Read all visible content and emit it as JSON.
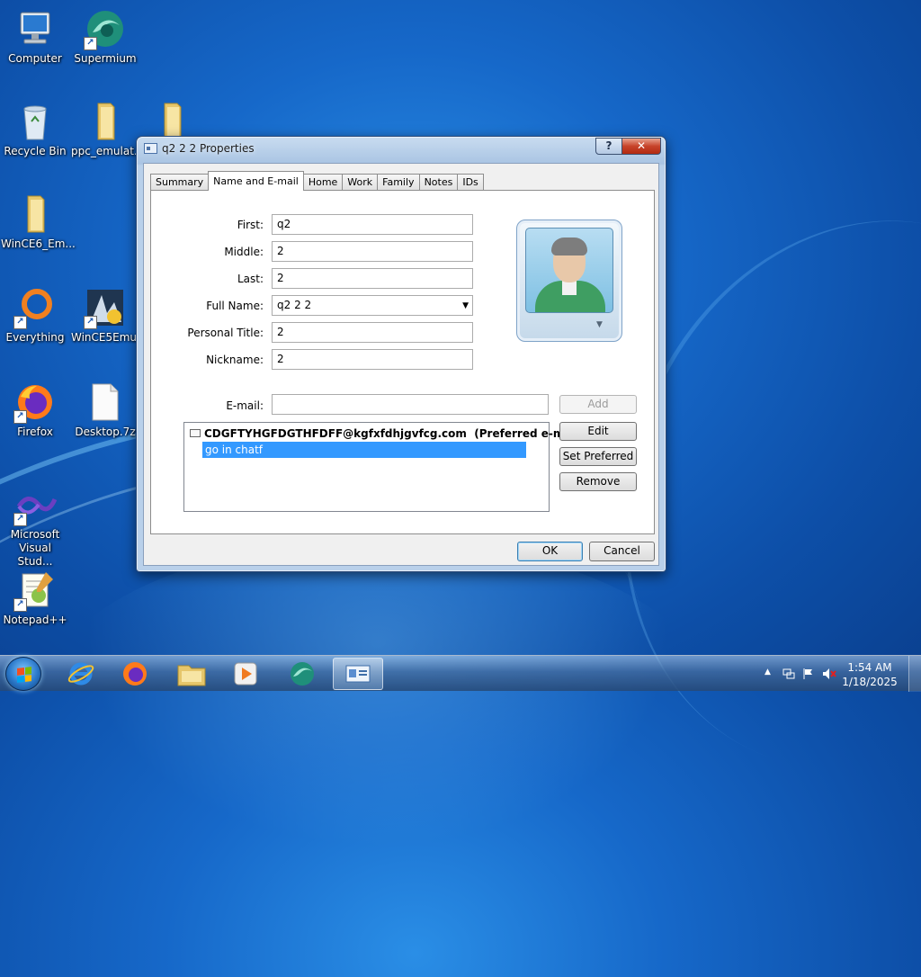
{
  "desktop": {
    "icons": [
      {
        "label": "Computer",
        "icon": "computer-icon"
      },
      {
        "label": "Supermium",
        "icon": "supermium-icon"
      },
      {
        "label": "Recycle Bin",
        "icon": "recycle-bin-icon"
      },
      {
        "label": "ppc_emulat...",
        "icon": "folder-icon"
      },
      {
        "label": "WinCE6_Em...",
        "icon": "folder-icon"
      },
      {
        "label": "Everything",
        "icon": "everything-icon"
      },
      {
        "label": "WinCE5Emu...",
        "icon": "wince5emu-icon"
      },
      {
        "label": "Firefox",
        "icon": "firefox-icon"
      },
      {
        "label": "Desktop.7z",
        "icon": "file-icon"
      },
      {
        "label": "Microsoft Visual Stud...",
        "icon": "visual-studio-icon"
      },
      {
        "label": "Notepad++",
        "icon": "notepadpp-icon"
      }
    ]
  },
  "dialog": {
    "title": "q2 2 2 Properties",
    "help_label": "?",
    "close_label": "✕",
    "tabs": [
      {
        "label": "Summary",
        "active": false
      },
      {
        "label": "Name and E-mail",
        "active": true
      },
      {
        "label": "Home",
        "active": false
      },
      {
        "label": "Work",
        "active": false
      },
      {
        "label": "Family",
        "active": false
      },
      {
        "label": "Notes",
        "active": false
      },
      {
        "label": "IDs",
        "active": false
      }
    ],
    "form": {
      "first": {
        "label": "First:",
        "value": "q2"
      },
      "middle": {
        "label": "Middle:",
        "value": "2"
      },
      "last": {
        "label": "Last:",
        "value": "2"
      },
      "full_name": {
        "label": "Full Name:",
        "value": "q2 2 2"
      },
      "personal_title": {
        "label": "Personal Title:",
        "value": "2"
      },
      "nickname": {
        "label": "Nickname:",
        "value": "2"
      },
      "email": {
        "label": "E-mail:",
        "value": ""
      }
    },
    "email_list": {
      "address": "CDGFTYHGFDGTHFDFF@kgfxfdhjgvfcg.com",
      "preferred_note": "(Preferred e-mail)",
      "editing_text": "go in chatf"
    },
    "buttons": {
      "add": "Add",
      "edit": "Edit",
      "set_preferred": "Set Preferred",
      "remove": "Remove",
      "ok": "OK",
      "cancel": "Cancel"
    }
  },
  "taskbar": {
    "items": [
      "internet-explorer-icon",
      "firefox-icon",
      "explorer-folder-icon",
      "media-player-icon",
      "supermium-icon",
      "contacts-icon"
    ],
    "clock_time": "1:54 AM",
    "clock_date": "1/18/2025"
  }
}
